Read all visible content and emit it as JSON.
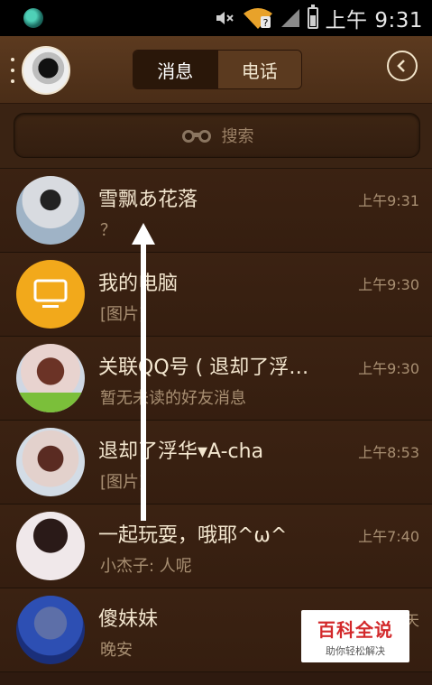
{
  "status_bar": {
    "time": "上午 9:31",
    "icons": [
      "app-icon",
      "mute-icon",
      "wifi-icon",
      "signal-icon",
      "battery-icon"
    ]
  },
  "header": {
    "tabs": [
      {
        "label": "消息",
        "active": true
      },
      {
        "label": "电话",
        "active": false
      }
    ],
    "back_icon": "back-icon"
  },
  "search": {
    "placeholder": "搜索",
    "icon": "binoculars-icon"
  },
  "conversations": [
    {
      "name": "雪飘あ花落",
      "message": "？",
      "time": "上午9:31"
    },
    {
      "name": "我的电脑",
      "message": "[图片]",
      "time": "上午9:30"
    },
    {
      "name": "关联QQ号 ( 退却了浮…",
      "message": "暂无未读的好友消息",
      "time": "上午9:30"
    },
    {
      "name": "退却了浮华▾A-cha",
      "message": "[图片]",
      "time": "上午8:53"
    },
    {
      "name": "一起玩耍，哦耶^ω^",
      "message": "小杰子: 人呢",
      "time": "上午7:40"
    },
    {
      "name": "傻妹妹",
      "message": "晚安",
      "time": "天"
    }
  ],
  "watermark": {
    "title": "百科全说",
    "subtitle": "助你轻松解决"
  },
  "colors": {
    "accent_orange": "#f2a91b",
    "watermark_red": "#d3292b"
  }
}
